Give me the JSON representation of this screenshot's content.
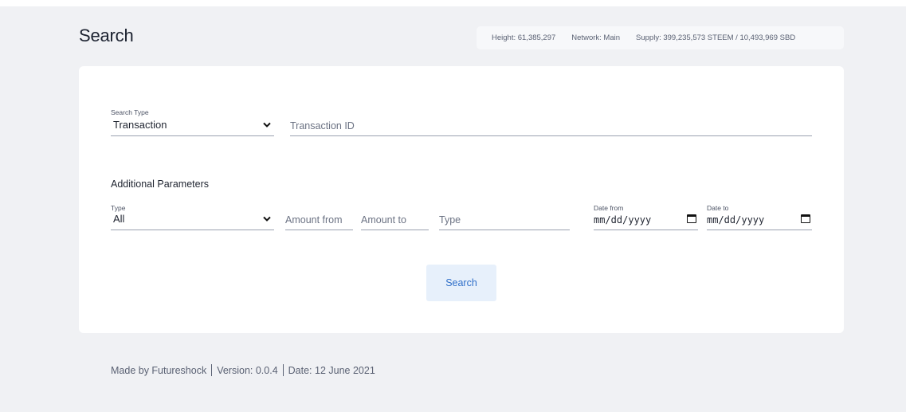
{
  "page": {
    "title": "Search"
  },
  "stats": {
    "height": "Height: 61,385,297",
    "network": "Network: Main",
    "supply": "Supply: 399,235,573 STEEM / 10,493,969 SBD"
  },
  "search_form": {
    "search_type_label": "Search Type",
    "search_type_value": "Transaction",
    "transaction_id_placeholder": "Transaction ID",
    "additional_heading": "Additional Parameters",
    "type_label": "Type",
    "type_value": "All",
    "amount_from_placeholder": "Amount from",
    "amount_to_placeholder": "Amount to",
    "type_placeholder": "Type",
    "date_from_label": "Date from",
    "date_from_value": "mm/dd/yyyy",
    "date_to_label": "Date to",
    "date_to_value": "mm/dd/yyyy",
    "search_button_label": "Search"
  },
  "footer": {
    "made_by": "Made by Futureshock",
    "version": "Version: 0.0.4",
    "date": "Date: 12 June 2021"
  },
  "icons": {
    "dropdown": "chevron-down-icon",
    "calendar": "calendar-icon"
  },
  "colors": {
    "background": "#f0f1f4",
    "card": "#ffffff",
    "button_bg": "#e7f0fb",
    "button_text": "#2f6fc9"
  }
}
